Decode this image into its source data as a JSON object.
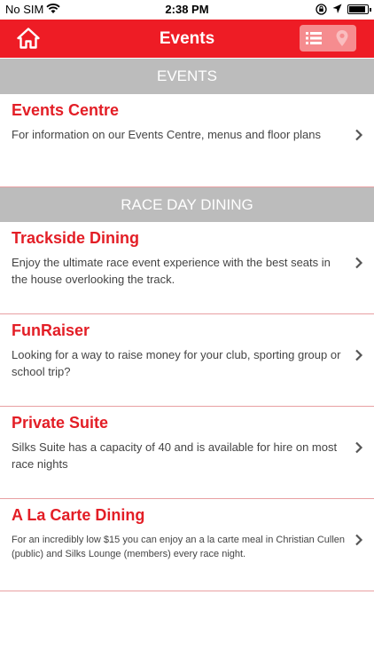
{
  "status_bar": {
    "carrier": "No SIM",
    "time": "2:38 PM",
    "battery_level": 0.9
  },
  "nav": {
    "title": "Events",
    "home_icon": "home-icon",
    "list_icon": "list-icon",
    "map_icon": "map-pin-icon",
    "accent": "#ee1c25"
  },
  "sections": {
    "events_header": "EVENTS",
    "dining_header": "RACE DAY DINING"
  },
  "items": [
    {
      "title": "Events Centre",
      "description": "For information on our Events Centre, menus and floor plans"
    },
    {
      "title": "Trackside Dining",
      "description": "Enjoy the ultimate race event experience with the best seats in the house overlooking the track."
    },
    {
      "title": "FunRaiser",
      "description": "Looking for a way to raise money for your club, sporting group or school trip?"
    },
    {
      "title": "Private Suite",
      "description": "Silks Suite has a capacity of 40 and is available for hire on most race nights"
    },
    {
      "title": "A La Carte Dining",
      "description": "For an incredibly low $15 you can enjoy an a la carte meal in Christian Cullen (public) and Silks Lounge (members) every race night."
    }
  ]
}
